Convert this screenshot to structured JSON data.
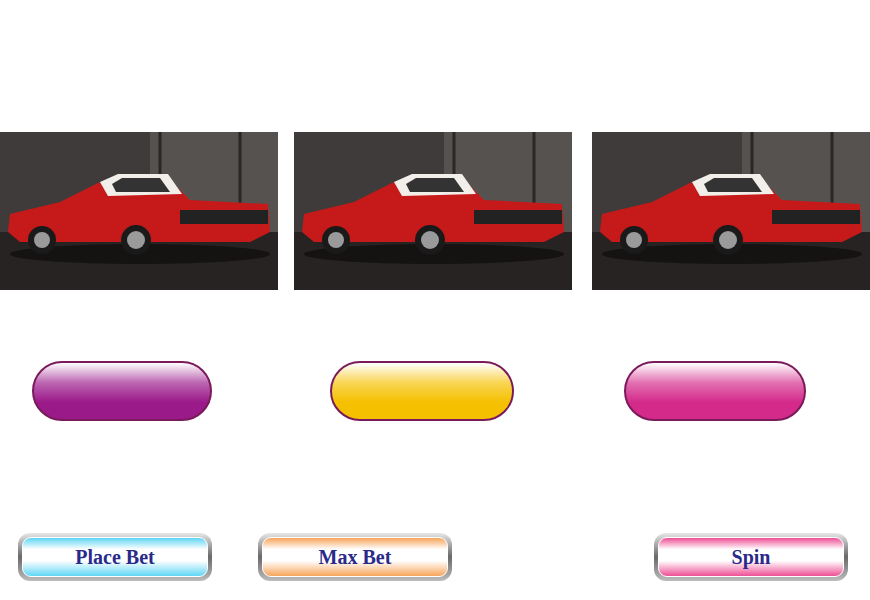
{
  "reels": [
    {
      "symbol": "car"
    },
    {
      "symbol": "car"
    },
    {
      "symbol": "car"
    }
  ],
  "lights": [
    {
      "color": "#9b1a8a"
    },
    {
      "color": "#f5c000"
    },
    {
      "color": "#d42a8a"
    }
  ],
  "buttons": [
    {
      "label": "Place Bet",
      "color": "#5fd6f5"
    },
    {
      "label": "Max Bet",
      "color": "#f7a55a"
    },
    {
      "label": "Spin",
      "color": "#ee4f95"
    }
  ]
}
